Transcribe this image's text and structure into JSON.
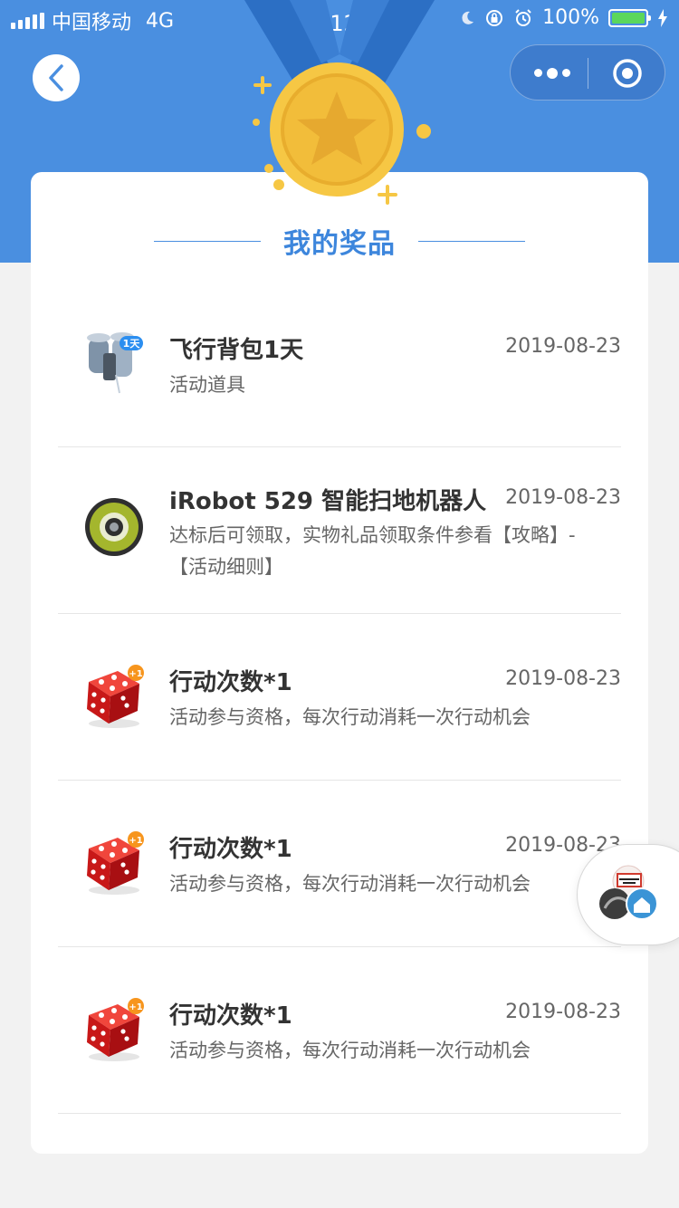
{
  "status_bar": {
    "carrier": "中国移动",
    "network": "4G",
    "time": "上午12:45",
    "battery": "100%"
  },
  "page": {
    "title": "我的奖品"
  },
  "prizes": [
    {
      "name": "飞行背包1天",
      "date": "2019-08-23",
      "desc": "活动道具",
      "icon": "jetpack-icon",
      "badge": "1天"
    },
    {
      "name": "iRobot 529 智能扫地机器人",
      "date": "2019-08-23",
      "desc": "达标后可领取，实物礼品领取条件参看【攻略】-【活动细则】",
      "icon": "robot-vacuum-icon"
    },
    {
      "name": "行动次数*1",
      "date": "2019-08-23",
      "desc": "活动参与资格，每次行动消耗一次行动机会",
      "icon": "dice-icon",
      "badge": "+1"
    },
    {
      "name": "行动次数*1",
      "date": "2019-08-23",
      "desc": "活动参与资格，每次行动消耗一次行动机会",
      "icon": "dice-icon",
      "badge": "+1"
    },
    {
      "name": "行动次数*1",
      "date": "2019-08-23",
      "desc": "活动参与资格，每次行动消耗一次行动机会",
      "icon": "dice-icon",
      "badge": "+1"
    }
  ],
  "colors": {
    "header": "#4a8fe0",
    "title": "#3d86dc",
    "medal": "#f6c744",
    "dice": "#d81e1e"
  }
}
